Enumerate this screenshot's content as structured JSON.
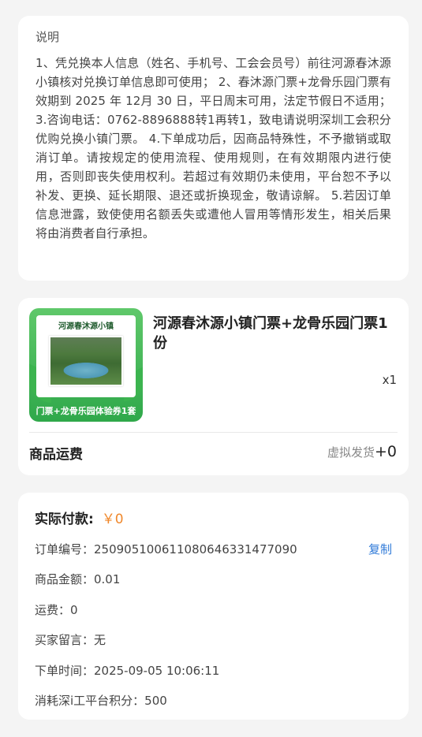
{
  "notes": {
    "title": "说明",
    "body": "1、凭兑换本人信息（姓名、手机号、工会会员号）前往河源春沐源小镇核对兑换订单信息即可使用； 2、春沐源门票+龙骨乐园门票有效期到 2025 年 12月 30 日，平日周末可用，法定节假日不适用； 3.咨询电话：0762-8896888转1再转1，致电请说明深圳工会积分优购兑换小镇门票。 4.下单成功后，因商品特殊性，不予撤销或取消订单。请按规定的使用流程、使用规则，在有效期限内进行使用，否则即丧失使用权利。若超过有效期仍未使用，平台恕不予以补发、更换、延长期限、退还或折换现金，敬请谅解。 5.若因订单信息泄露，致使使用名额丢失或遭他人冒用等情形发生，相关后果将由消费者自行承担。"
  },
  "product": {
    "thumb_title": "河源春沐源小镇",
    "thumb_caption": "门票+龙骨乐园体验券1套",
    "name": "河源春沐源小镇门票+龙骨乐园门票1份",
    "quantity": "x1",
    "shipping_label": "商品运费",
    "shipping_method": "虚拟发货",
    "shipping_value": "+0"
  },
  "payment": {
    "label": "实际付款:",
    "amount": "￥0",
    "order_no": "订单编号：2509051006110806463314770​90",
    "copy_label": "复制",
    "goods_amount": "商品金额：0.01",
    "freight": "运费：0",
    "buyer_note": "买家留言：无",
    "order_time": "下单时间：2025-09-05 10:06:11",
    "points": "消耗深i工平台积分：500"
  }
}
